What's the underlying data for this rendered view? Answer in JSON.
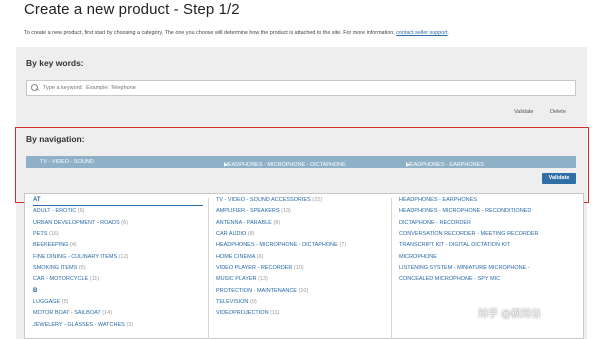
{
  "page": {
    "title": "Create a new product - Step 1/2",
    "intro": "To create a new product, first start by choosing a category. The one you choose will determine how the product is attached to the site. For more information, ",
    "intro_link": "contact seller support",
    "intro_end": "."
  },
  "keywords": {
    "title": "By key words:",
    "placeholder": "Type a keyword.  Example: Telephone",
    "validate_label": "Validate",
    "delete_label": "Delete"
  },
  "navigation": {
    "title": "By navigation:",
    "breadcrumb": [
      "TV - VIDEO - SOUND",
      "HEADPHONES - MICROPHONE - DICTAPHONE",
      "HEADPHONES - EARPHONES"
    ],
    "validate_label": "Validate"
  },
  "categories": {
    "letter_a": "AT",
    "letter_b": "B",
    "col1": [
      {
        "name": "ADULT - EROTIC",
        "count": "(6)"
      },
      {
        "name": "URBAN DEVELOPMENT - ROADS",
        "count": "(6)"
      },
      {
        "name": "PETS",
        "count": "(16)"
      },
      {
        "name": "BEEKEEPING",
        "count": "(4)"
      },
      {
        "name": "FINE DINING - CULINARY ITEMS",
        "count": "(12)"
      },
      {
        "name": "SMOKING ITEMS",
        "count": "(6)"
      },
      {
        "name": "CAR - MOTORCYCLE",
        "count": "(11)"
      }
    ],
    "col1b": [
      {
        "name": "LUGGAGE",
        "count": "(5)"
      },
      {
        "name": "MOTOR BOAT - SAILBOAT",
        "count": "(14)"
      },
      {
        "name": "JEWELERY - GLASSES - WATCHES",
        "count": "(3)"
      }
    ],
    "col2": [
      {
        "name": "TV - VIDEO - SOUND ACCESSORIES",
        "count": "(22)"
      },
      {
        "name": "AMPLIFIER - SPEAKERS",
        "count": "(13)"
      },
      {
        "name": "ANTENNA - PARABLE",
        "count": "(8)"
      },
      {
        "name": "CAR AUDIO",
        "count": "(8)"
      },
      {
        "name": "HEADPHONES - MICROPHONE - DICTAPHONE",
        "count": "(7)"
      },
      {
        "name": "HOME CINEMA",
        "count": "(6)"
      },
      {
        "name": "VIDEO PLAYER - RECORDER",
        "count": "(10)"
      },
      {
        "name": "MUSIC PLAYER",
        "count": "(13)"
      },
      {
        "name": "PROTECTION - MAINTENANCE",
        "count": "(10)"
      },
      {
        "name": "TELEVISION",
        "count": "(9)"
      },
      {
        "name": "VIDEOPROJECTION",
        "count": "(11)"
      }
    ],
    "col3": [
      {
        "name": "HEADPHONES - EARPHONES",
        "count": ""
      },
      {
        "name": "HEADPHONES - MICROPHONE - RECONDITIONED",
        "count": ""
      },
      {
        "name": "DICTAPHONE - RECORDER",
        "count": ""
      },
      {
        "name": "CONVERSATION RECORDER - MEETING RECORDER",
        "count": ""
      },
      {
        "name": "TRANSCRIPT KIT - DIGITAL DICTATION KIT",
        "count": ""
      },
      {
        "name": "MICROPHONE",
        "count": ""
      },
      {
        "name": "LISTENING SYSTEM - MINIATURE MICROPHONE -",
        "count": ""
      },
      {
        "name": "CONCEALED MICROPHONE - SPY MIC",
        "count": ""
      }
    ]
  },
  "watermark": "知乎 @枫知谷",
  "colors": {
    "accent": "#2f6fa6",
    "nav_bar": "#8fb1c8",
    "highlight_frame": "#d42b2b",
    "link": "#2a6aa8"
  }
}
